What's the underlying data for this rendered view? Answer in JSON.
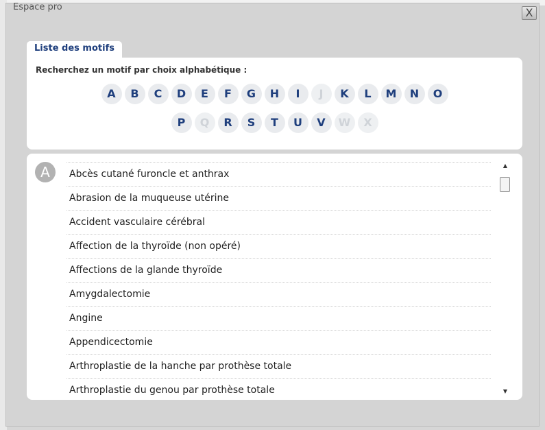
{
  "window": {
    "title": "Espace pro",
    "close_label": "X"
  },
  "tab": {
    "label": "Liste des motifs"
  },
  "alphabet": {
    "prompt": "Recherchez un motif par choix alphabétique :",
    "row1": [
      {
        "letter": "A",
        "enabled": true
      },
      {
        "letter": "B",
        "enabled": true
      },
      {
        "letter": "C",
        "enabled": true
      },
      {
        "letter": "D",
        "enabled": true
      },
      {
        "letter": "E",
        "enabled": true
      },
      {
        "letter": "F",
        "enabled": true
      },
      {
        "letter": "G",
        "enabled": true
      },
      {
        "letter": "H",
        "enabled": true
      },
      {
        "letter": "I",
        "enabled": true
      },
      {
        "letter": "J",
        "enabled": false
      },
      {
        "letter": "K",
        "enabled": true
      },
      {
        "letter": "L",
        "enabled": true
      },
      {
        "letter": "M",
        "enabled": true
      },
      {
        "letter": "N",
        "enabled": true
      },
      {
        "letter": "O",
        "enabled": true
      }
    ],
    "row2": [
      {
        "letter": "P",
        "enabled": true
      },
      {
        "letter": "Q",
        "enabled": false
      },
      {
        "letter": "R",
        "enabled": true
      },
      {
        "letter": "S",
        "enabled": true
      },
      {
        "letter": "T",
        "enabled": true
      },
      {
        "letter": "U",
        "enabled": true
      },
      {
        "letter": "V",
        "enabled": true
      },
      {
        "letter": "W",
        "enabled": false
      },
      {
        "letter": "X",
        "enabled": false
      }
    ]
  },
  "list": {
    "section_letter": "A",
    "items": [
      "Abcès cutané furoncle et anthrax",
      "Abrasion de la muqueuse utérine",
      "Accident vasculaire cérébral",
      "Affection de la thyroïde (non opéré)",
      "Affections de la glande thyroïde",
      "Amygdalectomie",
      "Angine",
      "Appendicectomie",
      "Arthroplastie de la hanche par prothèse totale",
      "Arthroplastie du genou par prothèse totale"
    ]
  },
  "scrollbar": {
    "up_icon": "▲",
    "down_icon": "▼"
  },
  "colors": {
    "letter_active": "#1f3f7d",
    "letter_disabled": "#cfd3d8",
    "section_badge": "#b2b2b2"
  }
}
